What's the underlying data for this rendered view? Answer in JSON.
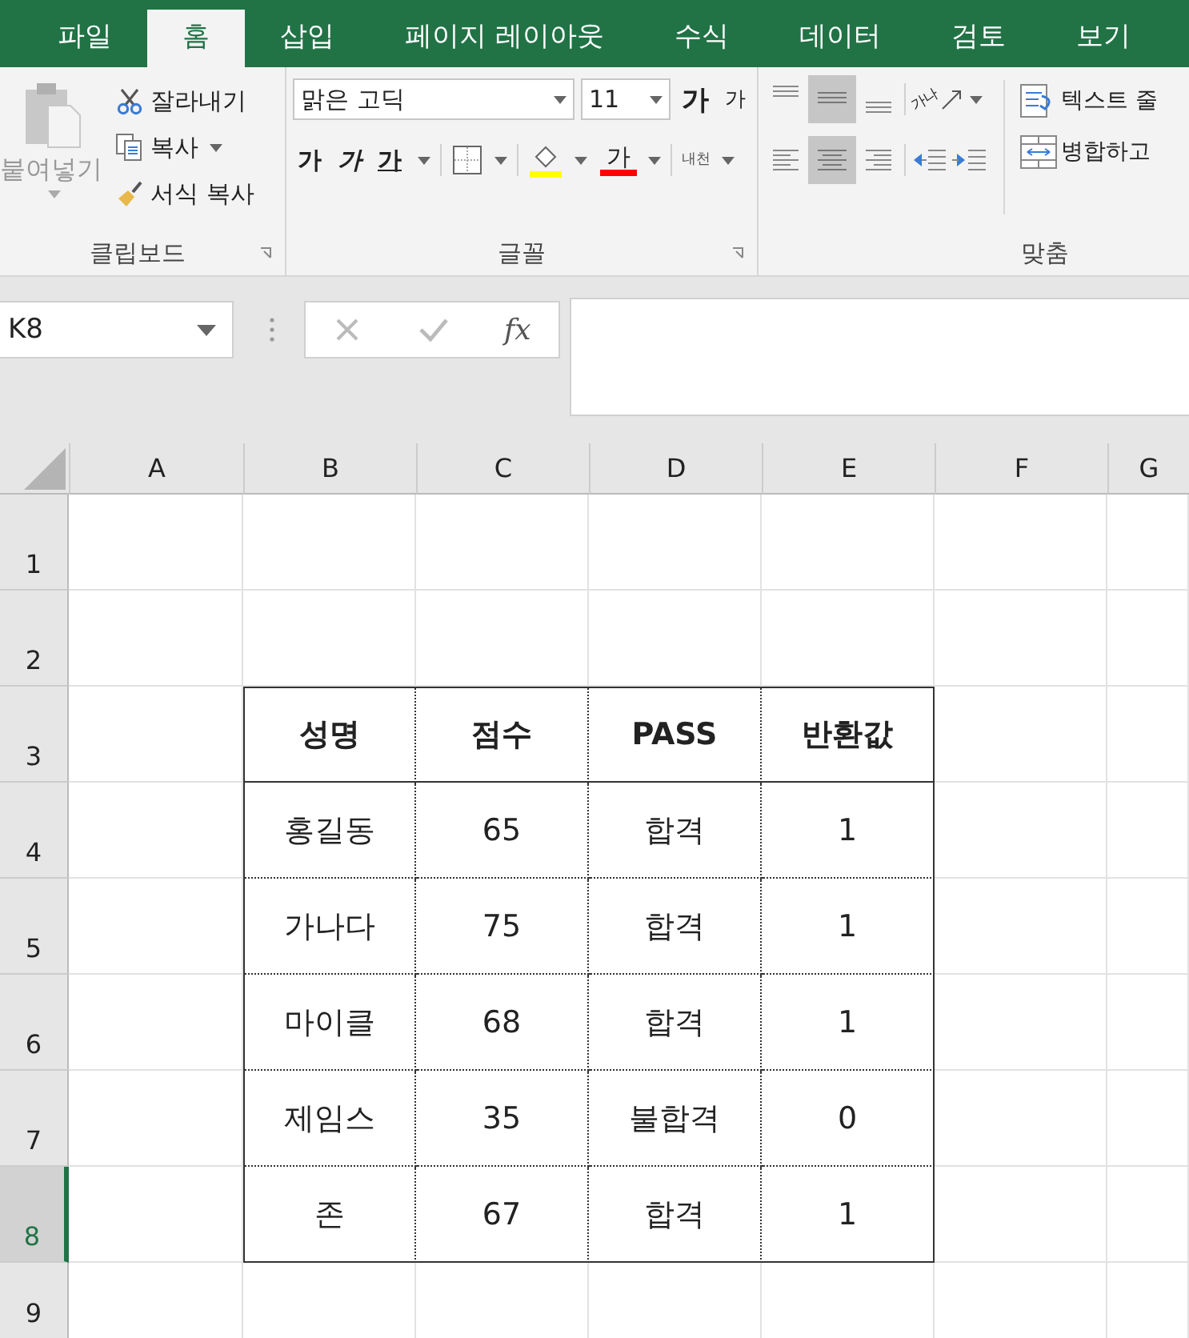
{
  "tabs": [
    {
      "label": "파일",
      "selected": false
    },
    {
      "label": "홈",
      "selected": true
    },
    {
      "label": "삽입",
      "selected": false
    },
    {
      "label": "페이지 레이아웃",
      "selected": false
    },
    {
      "label": "수식",
      "selected": false
    },
    {
      "label": "데이터",
      "selected": false
    },
    {
      "label": "검토",
      "selected": false
    },
    {
      "label": "보기",
      "selected": false
    }
  ],
  "clipboard": {
    "paste": {
      "label": "붙여넣기",
      "disabled": true
    },
    "cut": "잘라내기",
    "copy": "복사",
    "format_painter": "서식 복사",
    "group_label": "클립보드"
  },
  "font": {
    "name": "맑은 고딕",
    "size": "11",
    "grow": "가",
    "shrink": "가",
    "bold": "가",
    "italic": "가",
    "underline": "가",
    "font_color_label": "가",
    "phonetic": "내천",
    "group_label": "글꼴"
  },
  "alignment": {
    "orientation_text": "가나",
    "wrap_text": "텍스트 줄",
    "merge": "병합하고",
    "group_label": "맞춤"
  },
  "formula_bar": {
    "name_box": "K8",
    "cancel_disabled": true,
    "enter_disabled": true,
    "fx": "fx"
  },
  "columns": [
    "A",
    "B",
    "C",
    "D",
    "E",
    "F",
    "G"
  ],
  "rows": [
    {
      "label": "1",
      "selected": false
    },
    {
      "label": "2",
      "selected": false
    },
    {
      "label": "3",
      "selected": false
    },
    {
      "label": "4",
      "selected": false
    },
    {
      "label": "5",
      "selected": false
    },
    {
      "label": "6",
      "selected": false
    },
    {
      "label": "7",
      "selected": false
    },
    {
      "label": "8",
      "selected": true
    },
    {
      "label": "9",
      "selected": false
    }
  ],
  "table": {
    "header": [
      "성명",
      "점수",
      "PASS",
      "반환값"
    ],
    "rows": [
      [
        "홍길동",
        "65",
        "합격",
        "1"
      ],
      [
        "가나다",
        "75",
        "합격",
        "1"
      ],
      [
        "마이클",
        "68",
        "합격",
        "1"
      ],
      [
        "제임스",
        "35",
        "불합격",
        "0"
      ],
      [
        "존",
        "67",
        "합격",
        "1"
      ]
    ]
  }
}
